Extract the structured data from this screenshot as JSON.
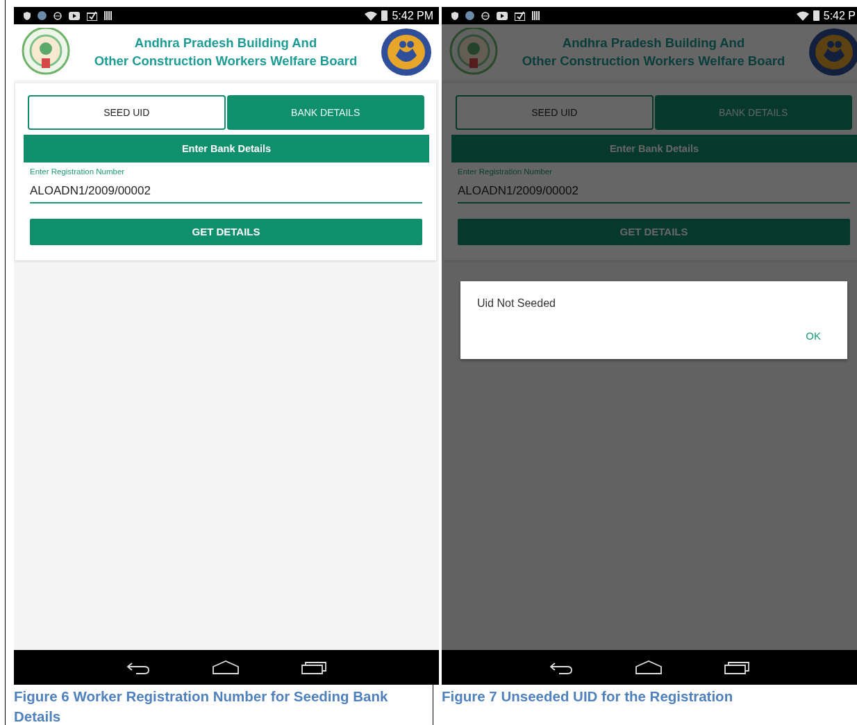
{
  "figures": [
    {
      "status_time": "5:42 PM",
      "header": {
        "title_lines": [
          "Andhra Pradesh Building And",
          "Other Construction Workers Welfare Board"
        ]
      },
      "tabs": [
        {
          "label": "SEED UID",
          "selected": false
        },
        {
          "label": "BANK DETAILS",
          "selected": true
        }
      ],
      "section_title": "Enter Bank Details",
      "field": {
        "label": "Enter Registration Number",
        "value": "ALOADN1/2009/00002"
      },
      "button": "GET DETAILS",
      "dimmed": false,
      "caption": "Figure 6 Worker Registration Number for Seeding Bank Details"
    },
    {
      "status_time": "5:42 P",
      "header": {
        "title_lines": [
          "Andhra Pradesh Building And",
          "Other Construction Workers Welfare Board"
        ]
      },
      "tabs": [
        {
          "label": "SEED UID",
          "selected": false
        },
        {
          "label": "BANK DETAILS",
          "selected": true
        }
      ],
      "section_title": "Enter Bank Details",
      "field": {
        "label": "Enter Registration Number",
        "value": "ALOADN1/2009/00002"
      },
      "button": "GET DETAILS",
      "dimmed": true,
      "dialog": {
        "message": "Uid Not Seeded",
        "button": "OK"
      },
      "caption": "Figure 7 Unseeded UID for the Registration"
    }
  ]
}
